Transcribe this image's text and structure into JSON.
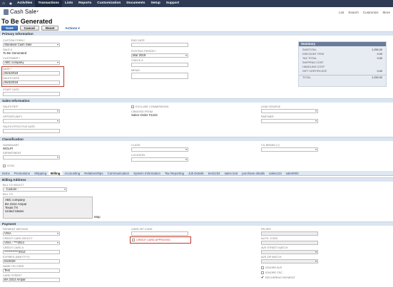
{
  "topnav": {
    "items": [
      "Activities",
      "Transactions",
      "Lists",
      "Reports",
      "Customization",
      "Documents",
      "Setup",
      "Support"
    ],
    "active_index": 1
  },
  "record": {
    "type": "Cash Sale",
    "status": "To Be Generated",
    "links": [
      "List",
      "Search",
      "Customize",
      "More"
    ]
  },
  "buttons": {
    "save": "Save",
    "cancel": "Cancel",
    "reset": "Reset",
    "actions": "Actions ▾"
  },
  "primary": {
    "header": "Primary Information",
    "custom_form_label": "CUSTOM FORM *",
    "custom_form_value": "Standard Cash Sale",
    "sale_no_label": "SALE #",
    "sale_no_value": "To Be Generated",
    "customer_label": "CUSTOMER *",
    "customer_value": "ABC company",
    "date_label": "DATE *",
    "date_value": "06/3/2019",
    "sales_date_label": "SALES DATE",
    "sales_date_value": "06/3/2019",
    "start_date_label": "START DATE",
    "end_date_label": "END DATE",
    "posting_period_label": "POSTING PERIOD *",
    "posting_period_value": "Mar 2019",
    "check_label": "CHECK #",
    "memo_label": "MEMO"
  },
  "summary": {
    "header": "Summary",
    "rows": [
      {
        "label": "SUBTOTAL",
        "value": "1,250.00"
      },
      {
        "label": "DISCOUNT ITEM",
        "value": "0.00"
      },
      {
        "label": "TAX TOTAL",
        "value": "0.00"
      },
      {
        "label": "SHIPPING COST",
        "value": ""
      },
      {
        "label": "HANDLING COST",
        "value": ""
      },
      {
        "label": "GIFT CERTIFICATE",
        "value": "0.00"
      }
    ],
    "total_label": "TOTAL",
    "total_value": "1,250.00"
  },
  "sales": {
    "header": "Sales Information",
    "sales_rep_label": "SALES REP",
    "opportunity_label": "OPPORTUNITY",
    "sales_effective_label": "SALES EFFECTIVE DATE",
    "exclude_commissions_label": "EXCLUDE COMMISSIONS",
    "created_from_label": "CREATED FROM",
    "created_from_value": "Sales Order #1242",
    "lead_source_label": "LEAD SOURCE",
    "partner_label": "PARTNER"
  },
  "classification": {
    "header": "Classification",
    "subsidiary_label": "SUBSIDIARY",
    "subsidiary_value": "WOLPI",
    "department_label": "DEPARTMENT",
    "class_label": "CLASS",
    "location_label": "LOCATION",
    "cc_label": "CIL BRAND (?)",
    "sync_label": "SYNC"
  },
  "tabs": [
    "Items",
    "Promotions",
    "Shipping",
    "Billing",
    "Accounting",
    "Relationships",
    "Communication",
    "System Information",
    "Tax Reporting",
    "Job Details",
    "test1234",
    "sales test",
    "purchase details",
    "sales123",
    "sale0000"
  ],
  "active_tab": 3,
  "billing": {
    "header": "Billing Address",
    "bill_to_select_label": "BILL TO SELECT",
    "bill_to_select_value": "- Custom -",
    "bill_to_label": "BILL TO",
    "bill_to_lines": [
      "ABC company",
      "BA 2314 Ampar",
      "Texas TX",
      "United States"
    ],
    "map_label": "Map"
  },
  "payment": {
    "header": "Payment",
    "method_label": "PAYMENT METHOD",
    "method_value": "VISA",
    "card_select_label": "CREDIT CARD SELECT",
    "card_select_value": "VISA - ***4014",
    "card_no_label": "CREDIT CARD #",
    "card_no_value": "************4014",
    "expires_label": "EXPIRES (MM/YYYY)",
    "expires_value": "04/2020",
    "name_label": "NAME ON CARD",
    "name_value": "Test",
    "street_label": "CARD STREET",
    "street_value": "BA 2314 Ampar",
    "zip_label": "CARD ZIP CODE",
    "approved_label": "CREDIT CARD APPROVED",
    "pnref_label": "PN REF",
    "auth_label": "AUTH. CODE",
    "avs_street_label": "AVS STREET MATCH",
    "avs_zip_label": "AVS ZIP MATCH",
    "ignore_avs_label": "IGNORE AVS",
    "ignore_csc_label": "IGNORE CSC",
    "recurring_label": "RECURRING PAYMENT"
  }
}
